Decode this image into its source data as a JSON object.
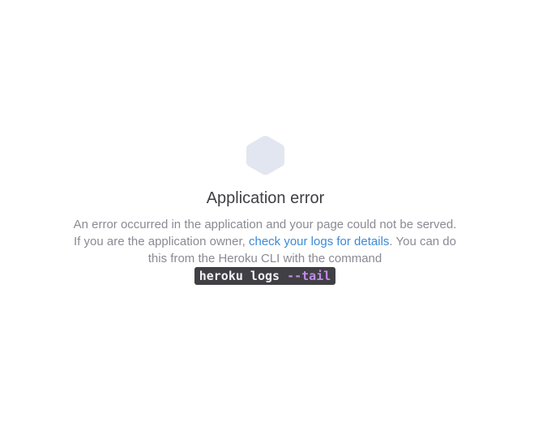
{
  "logo": {
    "icon": "hexagon-icon",
    "color": "#e2e6f0"
  },
  "error": {
    "title": "Application error",
    "message_part1": "An error occurred in the application and your page could not be served. If you are the application owner, ",
    "logs_link": "check your logs for details",
    "message_part2": ". You can do this from the Heroku CLI with the command",
    "command_base": "heroku logs ",
    "command_flag": "--tail"
  },
  "colors": {
    "title_text": "#3f3f44",
    "body_text": "#8a8a93",
    "link": "#3d8ad6",
    "code_bg": "#3f3f44",
    "code_flag": "#c28bea"
  }
}
